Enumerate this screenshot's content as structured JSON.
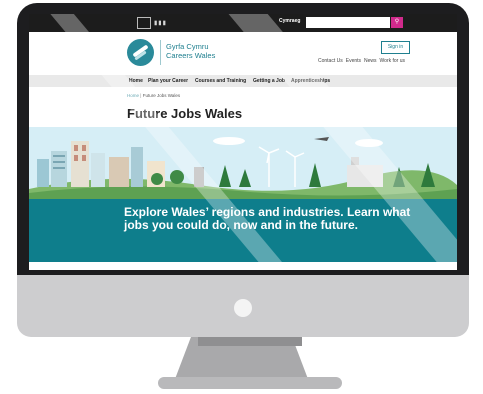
{
  "topbar": {
    "language_link": "Cymraeg",
    "search_placeholder": "",
    "search_button_icon": "search-icon",
    "gov_logo_icon": "welsh-government-logo"
  },
  "header": {
    "logo_line1": "Gyrfa Cymru",
    "logo_line2": "Careers Wales",
    "signin_label": "Sign in",
    "links": [
      "Contact Us",
      "Events",
      "News",
      "Work for us"
    ]
  },
  "nav": {
    "items": [
      "Home",
      "Plan your Career",
      "Courses and Training",
      "Getting a Job",
      "Apprenticeships"
    ]
  },
  "breadcrumb": {
    "home": "Home",
    "separator": "|",
    "current": "Future Jobs Wales"
  },
  "page": {
    "title": "Future Jobs Wales"
  },
  "banner": {
    "text": "Explore Wales’ regions and industries. Learn what jobs you could do, now and in the future."
  },
  "colors": {
    "brand_teal": "#0e7e8c",
    "search_button": "#d12a8c",
    "topbar": "#1c1c1c"
  }
}
